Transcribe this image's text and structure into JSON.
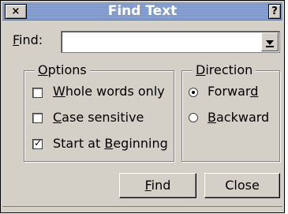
{
  "window": {
    "title": "Find Text",
    "close_glyph": "×",
    "help_glyph": "?"
  },
  "find": {
    "label_mnemonic": "F",
    "label_rest": "ind:",
    "value": ""
  },
  "options": {
    "legend_mnemonic": "O",
    "legend_rest": "ptions",
    "items": [
      {
        "pre": "",
        "mn": "W",
        "post": "hole words only",
        "checked": false
      },
      {
        "pre": "",
        "mn": "C",
        "post": "ase sensitive",
        "checked": false
      },
      {
        "pre": "Start at ",
        "mn": "B",
        "post": "eginning",
        "checked": true
      }
    ]
  },
  "direction": {
    "legend_mnemonic": "D",
    "legend_rest": "irection",
    "items": [
      {
        "pre": "Forwar",
        "mn": "d",
        "post": "",
        "selected": true
      },
      {
        "pre": "",
        "mn": "B",
        "post": "ackward",
        "selected": false
      }
    ]
  },
  "buttons": {
    "find_mnemonic": "F",
    "find_rest": "ind",
    "close": "Close"
  },
  "colors": {
    "dialog_bg": "#d4d0c8",
    "titlebar": "#8aa4d6"
  }
}
